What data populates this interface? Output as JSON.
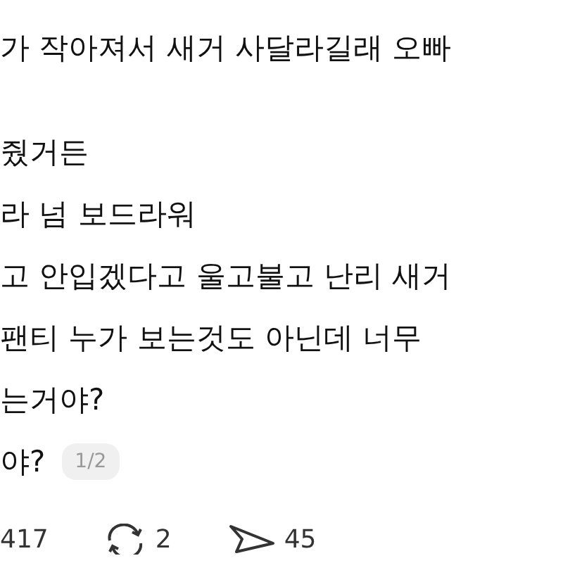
{
  "post_lines": [
    {
      "text": "가 작아져서 새거 사달라길래 오빠"
    },
    {
      "text": "줬거든"
    },
    {
      "text": "라 넘 보드라워"
    },
    {
      "text": "고 안입겠다고 울고불고 난리 새거"
    },
    {
      "text": "팬티 누가 보는것도 아닌데 너무"
    },
    {
      "text": "는거야?"
    },
    {
      "text": "야?",
      "badge": "1/2"
    }
  ],
  "stats": [
    {
      "kind": "likes",
      "count": "417"
    },
    {
      "kind": "reposts",
      "count": "2"
    },
    {
      "kind": "shares",
      "count": "45"
    }
  ]
}
